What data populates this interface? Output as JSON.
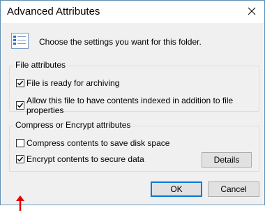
{
  "window": {
    "title": "Advanced Attributes",
    "close_icon": "close-icon"
  },
  "header": {
    "icon": "attributes-list-icon",
    "text": "Choose the settings you want for this folder."
  },
  "file_attributes": {
    "legend": "File attributes",
    "items": [
      {
        "label": "File is ready for archiving",
        "checked": true
      },
      {
        "label": "Allow this file to have contents indexed in addition to file properties",
        "checked": true
      }
    ]
  },
  "compress_encrypt": {
    "legend": "Compress or Encrypt attributes",
    "items": [
      {
        "label": "Compress contents to save disk space",
        "checked": false
      },
      {
        "label": "Encrypt contents to secure data",
        "checked": true
      }
    ],
    "details_label": "Details"
  },
  "buttons": {
    "ok": "OK",
    "cancel": "Cancel"
  },
  "colors": {
    "annotation_arrow": "#e00000",
    "accent": "#0078d7"
  }
}
